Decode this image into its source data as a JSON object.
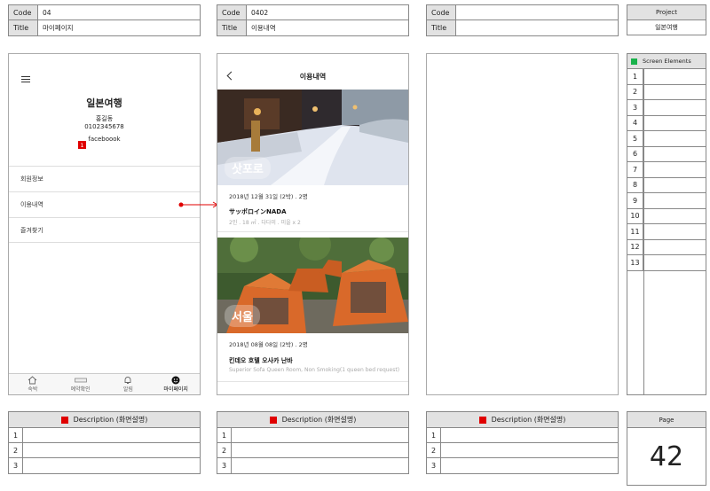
{
  "header_tables": [
    {
      "code_label": "Code",
      "code_value": "04",
      "title_label": "Title",
      "title_value": "마이페이지"
    },
    {
      "code_label": "Code",
      "code_value": "0402",
      "title_label": "Title",
      "title_value": "이용내역"
    },
    {
      "code_label": "Code",
      "code_value": "",
      "title_label": "Title",
      "title_value": ""
    }
  ],
  "project": {
    "label": "Project",
    "value": "일본여행"
  },
  "screen1": {
    "title": "일본여행",
    "user_name": "홍길동",
    "phone": "0102345678",
    "facebook": "faceboook",
    "marker": "1",
    "menu": [
      "회원정보",
      "이용내역",
      "즐겨찾기"
    ],
    "tabs": [
      "숙박",
      "예약확인",
      "알림",
      "마이페이지"
    ]
  },
  "screen2": {
    "title": "이용내역",
    "cards": [
      {
        "city": "삿포로",
        "date": "2018년 12월 31일 (2박) . 2명",
        "name": "サッポロインNADA",
        "desc": "2인 . 18 ㎡ . 다다미 . 미을 x 2"
      },
      {
        "city": "서울",
        "date": "2018년 08월 08일 (2박) . 2명",
        "name": "킨데오 호텔 오사카 난바",
        "desc": "Superior Sofa Queen Room, Non Smoking(1 queen bed request)"
      }
    ]
  },
  "screen_elements": {
    "title": "Screen Elements",
    "rows": [
      "1",
      "2",
      "3",
      "4",
      "5",
      "6",
      "7",
      "8",
      "9",
      "10",
      "11",
      "12",
      "13"
    ]
  },
  "descriptions": [
    {
      "title": "Description (화면설명)",
      "rows": [
        "1",
        "2",
        "3"
      ]
    },
    {
      "title": "Description (화면설명)",
      "rows": [
        "1",
        "2",
        "3"
      ]
    },
    {
      "title": "Description (화면설명)",
      "rows": [
        "1",
        "2",
        "3"
      ]
    }
  ],
  "page": {
    "label": "Page",
    "number": "42"
  },
  "colors": {
    "marker_red": "#e00000",
    "screen_elements_green": "#19b24b",
    "header_gray": "#e2e2e2"
  }
}
